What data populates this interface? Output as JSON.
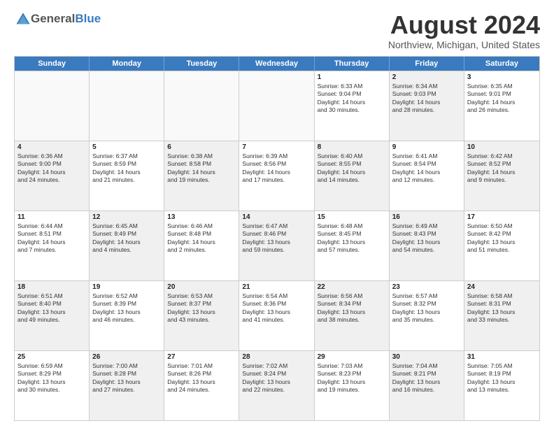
{
  "logo": {
    "general": "General",
    "blue": "Blue"
  },
  "title": "August 2024",
  "location": "Northview, Michigan, United States",
  "days_of_week": [
    "Sunday",
    "Monday",
    "Tuesday",
    "Wednesday",
    "Thursday",
    "Friday",
    "Saturday"
  ],
  "weeks": [
    [
      {
        "day": "",
        "info": "",
        "empty": true
      },
      {
        "day": "",
        "info": "",
        "empty": true
      },
      {
        "day": "",
        "info": "",
        "empty": true
      },
      {
        "day": "",
        "info": "",
        "empty": true
      },
      {
        "day": "1",
        "info": "Sunrise: 6:33 AM\nSunset: 9:04 PM\nDaylight: 14 hours\nand 30 minutes.",
        "shaded": false
      },
      {
        "day": "2",
        "info": "Sunrise: 6:34 AM\nSunset: 9:03 PM\nDaylight: 14 hours\nand 28 minutes.",
        "shaded": true
      },
      {
        "day": "3",
        "info": "Sunrise: 6:35 AM\nSunset: 9:01 PM\nDaylight: 14 hours\nand 26 minutes.",
        "shaded": false
      }
    ],
    [
      {
        "day": "4",
        "info": "Sunrise: 6:36 AM\nSunset: 9:00 PM\nDaylight: 14 hours\nand 24 minutes.",
        "shaded": true
      },
      {
        "day": "5",
        "info": "Sunrise: 6:37 AM\nSunset: 8:59 PM\nDaylight: 14 hours\nand 21 minutes.",
        "shaded": false
      },
      {
        "day": "6",
        "info": "Sunrise: 6:38 AM\nSunset: 8:58 PM\nDaylight: 14 hours\nand 19 minutes.",
        "shaded": true
      },
      {
        "day": "7",
        "info": "Sunrise: 6:39 AM\nSunset: 8:56 PM\nDaylight: 14 hours\nand 17 minutes.",
        "shaded": false
      },
      {
        "day": "8",
        "info": "Sunrise: 6:40 AM\nSunset: 8:55 PM\nDaylight: 14 hours\nand 14 minutes.",
        "shaded": true
      },
      {
        "day": "9",
        "info": "Sunrise: 6:41 AM\nSunset: 8:54 PM\nDaylight: 14 hours\nand 12 minutes.",
        "shaded": false
      },
      {
        "day": "10",
        "info": "Sunrise: 6:42 AM\nSunset: 8:52 PM\nDaylight: 14 hours\nand 9 minutes.",
        "shaded": true
      }
    ],
    [
      {
        "day": "11",
        "info": "Sunrise: 6:44 AM\nSunset: 8:51 PM\nDaylight: 14 hours\nand 7 minutes.",
        "shaded": false
      },
      {
        "day": "12",
        "info": "Sunrise: 6:45 AM\nSunset: 8:49 PM\nDaylight: 14 hours\nand 4 minutes.",
        "shaded": true
      },
      {
        "day": "13",
        "info": "Sunrise: 6:46 AM\nSunset: 8:48 PM\nDaylight: 14 hours\nand 2 minutes.",
        "shaded": false
      },
      {
        "day": "14",
        "info": "Sunrise: 6:47 AM\nSunset: 8:46 PM\nDaylight: 13 hours\nand 59 minutes.",
        "shaded": true
      },
      {
        "day": "15",
        "info": "Sunrise: 6:48 AM\nSunset: 8:45 PM\nDaylight: 13 hours\nand 57 minutes.",
        "shaded": false
      },
      {
        "day": "16",
        "info": "Sunrise: 6:49 AM\nSunset: 8:43 PM\nDaylight: 13 hours\nand 54 minutes.",
        "shaded": true
      },
      {
        "day": "17",
        "info": "Sunrise: 6:50 AM\nSunset: 8:42 PM\nDaylight: 13 hours\nand 51 minutes.",
        "shaded": false
      }
    ],
    [
      {
        "day": "18",
        "info": "Sunrise: 6:51 AM\nSunset: 8:40 PM\nDaylight: 13 hours\nand 49 minutes.",
        "shaded": true
      },
      {
        "day": "19",
        "info": "Sunrise: 6:52 AM\nSunset: 8:39 PM\nDaylight: 13 hours\nand 46 minutes.",
        "shaded": false
      },
      {
        "day": "20",
        "info": "Sunrise: 6:53 AM\nSunset: 8:37 PM\nDaylight: 13 hours\nand 43 minutes.",
        "shaded": true
      },
      {
        "day": "21",
        "info": "Sunrise: 6:54 AM\nSunset: 8:36 PM\nDaylight: 13 hours\nand 41 minutes.",
        "shaded": false
      },
      {
        "day": "22",
        "info": "Sunrise: 6:56 AM\nSunset: 8:34 PM\nDaylight: 13 hours\nand 38 minutes.",
        "shaded": true
      },
      {
        "day": "23",
        "info": "Sunrise: 6:57 AM\nSunset: 8:32 PM\nDaylight: 13 hours\nand 35 minutes.",
        "shaded": false
      },
      {
        "day": "24",
        "info": "Sunrise: 6:58 AM\nSunset: 8:31 PM\nDaylight: 13 hours\nand 33 minutes.",
        "shaded": true
      }
    ],
    [
      {
        "day": "25",
        "info": "Sunrise: 6:59 AM\nSunset: 8:29 PM\nDaylight: 13 hours\nand 30 minutes.",
        "shaded": false
      },
      {
        "day": "26",
        "info": "Sunrise: 7:00 AM\nSunset: 8:28 PM\nDaylight: 13 hours\nand 27 minutes.",
        "shaded": true
      },
      {
        "day": "27",
        "info": "Sunrise: 7:01 AM\nSunset: 8:26 PM\nDaylight: 13 hours\nand 24 minutes.",
        "shaded": false
      },
      {
        "day": "28",
        "info": "Sunrise: 7:02 AM\nSunset: 8:24 PM\nDaylight: 13 hours\nand 22 minutes.",
        "shaded": true
      },
      {
        "day": "29",
        "info": "Sunrise: 7:03 AM\nSunset: 8:23 PM\nDaylight: 13 hours\nand 19 minutes.",
        "shaded": false
      },
      {
        "day": "30",
        "info": "Sunrise: 7:04 AM\nSunset: 8:21 PM\nDaylight: 13 hours\nand 16 minutes.",
        "shaded": true
      },
      {
        "day": "31",
        "info": "Sunrise: 7:05 AM\nSunset: 8:19 PM\nDaylight: 13 hours\nand 13 minutes.",
        "shaded": false
      }
    ]
  ]
}
